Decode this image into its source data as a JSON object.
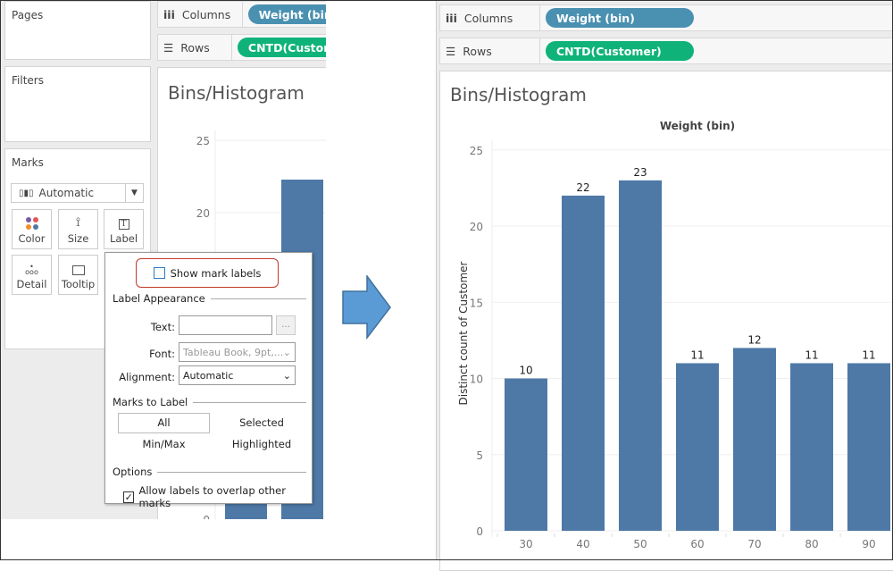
{
  "left": {
    "cards": {
      "pages": "Pages",
      "filters": "Filters",
      "marks": "Marks"
    },
    "marks_type": "Automatic",
    "mark_buttons": [
      {
        "label": "Color",
        "icon": "color-dots-icon"
      },
      {
        "label": "Size",
        "icon": "size-icon"
      },
      {
        "label": "Label",
        "icon": "label-text-icon"
      },
      {
        "label": "Detail",
        "icon": "detail-dots-icon"
      },
      {
        "label": "Tooltip",
        "icon": "tooltip-icon"
      }
    ],
    "columns_label": "Columns",
    "columns_pill": "Weight (bin)",
    "rows_label": "Rows",
    "rows_pill": "CNTD(Customer)",
    "sheet_title": "Bins/Histogram",
    "y_ticks": [
      "25",
      "20",
      "0"
    ],
    "popup": {
      "show_mark_labels": "Show mark labels",
      "show_mark_labels_checked": false,
      "label_appearance": "Label Appearance",
      "text_label": "Text:",
      "text_value": "",
      "more_button": "...",
      "font_label": "Font:",
      "font_value": "Tableau Book, 9pt,...",
      "alignment_label": "Alignment:",
      "alignment_value": "Automatic",
      "marks_to_label": "Marks to Label",
      "options_marks": [
        "All",
        "Selected",
        "Min/Max",
        "Highlighted"
      ],
      "selected_option": "All",
      "options": "Options",
      "allow_overlap": "Allow labels to overlap other marks",
      "allow_overlap_checked": true
    }
  },
  "right": {
    "columns_label": "Columns",
    "columns_pill": "Weight (bin)",
    "rows_label": "Rows",
    "rows_pill": "CNTD(Customer)",
    "sheet_title": "Bins/Histogram"
  },
  "chart_data": {
    "type": "bar",
    "title": "Weight (bin)",
    "xlabel": "",
    "ylabel": "Distinct count of Customer",
    "categories": [
      "30",
      "40",
      "50",
      "60",
      "70",
      "80",
      "90"
    ],
    "values": [
      10,
      22,
      23,
      11,
      12,
      11,
      11
    ],
    "ylim": [
      0,
      25
    ],
    "yticks": [
      0,
      5,
      10,
      15,
      20,
      25
    ],
    "grid": true,
    "data_labels": true,
    "bar_color": "#4e79a7"
  }
}
